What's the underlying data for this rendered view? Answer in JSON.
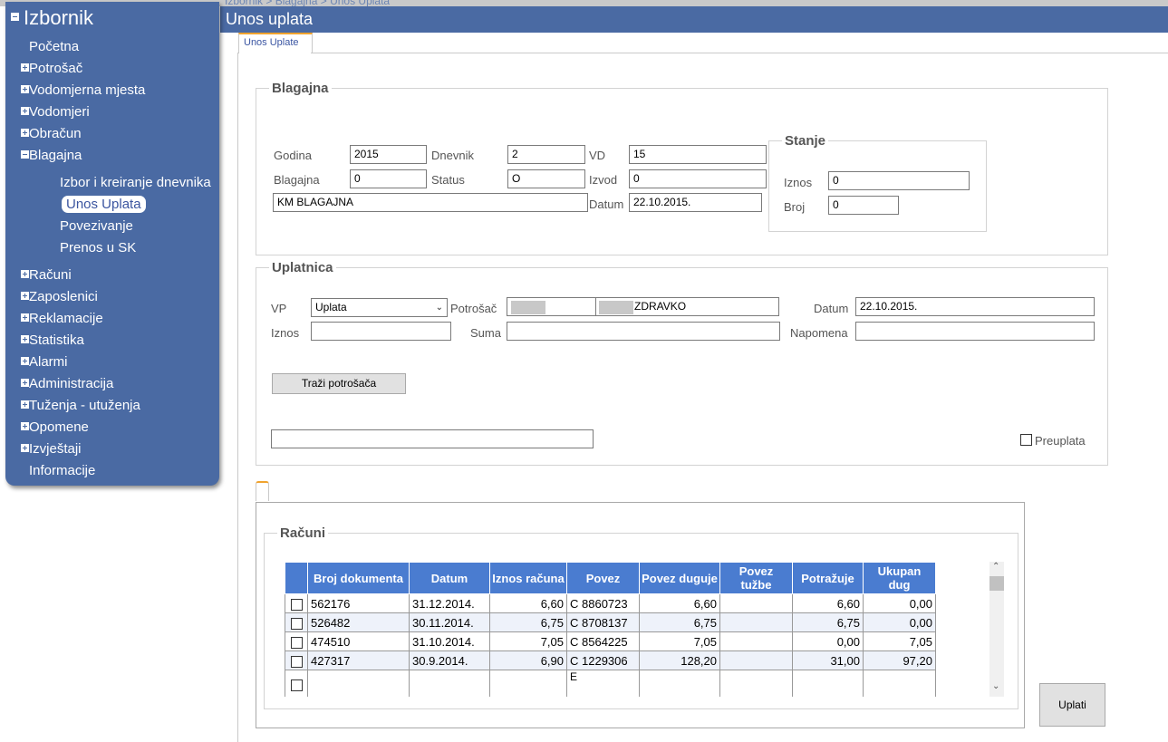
{
  "breadcrumb": "Izbornik > Blagajna > Unos Uplata",
  "page_title": "Unos uplata",
  "sidebar": {
    "title": "Izbornik",
    "items": [
      {
        "label": "Početna",
        "expander": "none"
      },
      {
        "label": "Potrošač",
        "expander": "plus"
      },
      {
        "label": "Vodomjerna mjesta",
        "expander": "plus"
      },
      {
        "label": "Vodomjeri",
        "expander": "plus"
      },
      {
        "label": "Obračun",
        "expander": "plus"
      },
      {
        "label": "Blagajna",
        "expander": "minus"
      },
      {
        "label": "Računi",
        "expander": "plus"
      },
      {
        "label": "Zaposlenici",
        "expander": "plus"
      },
      {
        "label": "Reklamacije",
        "expander": "plus"
      },
      {
        "label": "Statistika",
        "expander": "plus"
      },
      {
        "label": "Alarmi",
        "expander": "plus"
      },
      {
        "label": "Administracija",
        "expander": "plus"
      },
      {
        "label": "Tuženja - utuženja",
        "expander": "plus"
      },
      {
        "label": "Opomene",
        "expander": "plus"
      },
      {
        "label": "Izvještaji",
        "expander": "plus"
      },
      {
        "label": "Informacije",
        "expander": "none"
      }
    ],
    "blagajna_sub": [
      "Izbor i kreiranje dnevnika",
      "Unos Uplata",
      "Povezivanje",
      "Prenos u SK"
    ],
    "active_sub": "Unos Uplata"
  },
  "tab_label": "Unos Uplate",
  "blagajna": {
    "legend": "Blagajna",
    "godina_label": "Godina",
    "godina": "2015",
    "dnevnik_label": "Dnevnik",
    "dnevnik": "2",
    "vd_label": "VD",
    "vd": "15",
    "blagajna_label": "Blagajna",
    "blagajna": "0",
    "status_label": "Status",
    "status": "O",
    "izvod_label": "Izvod",
    "izvod": "0",
    "naziv": "KM BLAGAJNA",
    "datum_label": "Datum",
    "datum": "22.10.2015.",
    "stanje": {
      "legend": "Stanje",
      "iznos_label": "Iznos",
      "iznos": "0",
      "broj_label": "Broj",
      "broj": "0"
    }
  },
  "uplatnica": {
    "legend": "Uplatnica",
    "vp_label": "VP",
    "vp_selected": "Uplata",
    "potrosac_label": "Potrošač",
    "potrosac_name": "ZDRAVKO",
    "datum_label": "Datum",
    "datum": "22.10.2015.",
    "iznos_label": "Iznos",
    "iznos": "",
    "suma_label": "Suma",
    "suma": "",
    "napomena_label": "Napomena",
    "napomena": "",
    "trazi_button": "Traži potrošača",
    "preuplata_label": "Preuplata"
  },
  "racuni": {
    "legend": "Računi",
    "headers": [
      "",
      "Broj dokumenta",
      "Datum",
      "Iznos računa",
      "Povez",
      "Povez duguje",
      "Povez tužbe",
      "Potražuje",
      "Ukupan dug"
    ],
    "rows": [
      [
        "562176",
        "31.12.2014.",
        "6,60",
        "C 8860723",
        "6,60",
        "",
        "6,60",
        "0,00"
      ],
      [
        "526482",
        "30.11.2014.",
        "6,75",
        "C 8708137",
        "6,75",
        "",
        "6,75",
        "0,00"
      ],
      [
        "474510",
        "31.10.2014.",
        "7,05",
        "C 8564225",
        "7,05",
        "",
        "0,00",
        "7,05"
      ],
      [
        "427317",
        "30.9.2014.",
        "6,90",
        "C 1229306",
        "128,20",
        "",
        "31,00",
        "97,20"
      ],
      [
        "",
        "",
        "",
        "E",
        "",
        "",
        "",
        ""
      ]
    ]
  },
  "uplati_button": "Uplati"
}
